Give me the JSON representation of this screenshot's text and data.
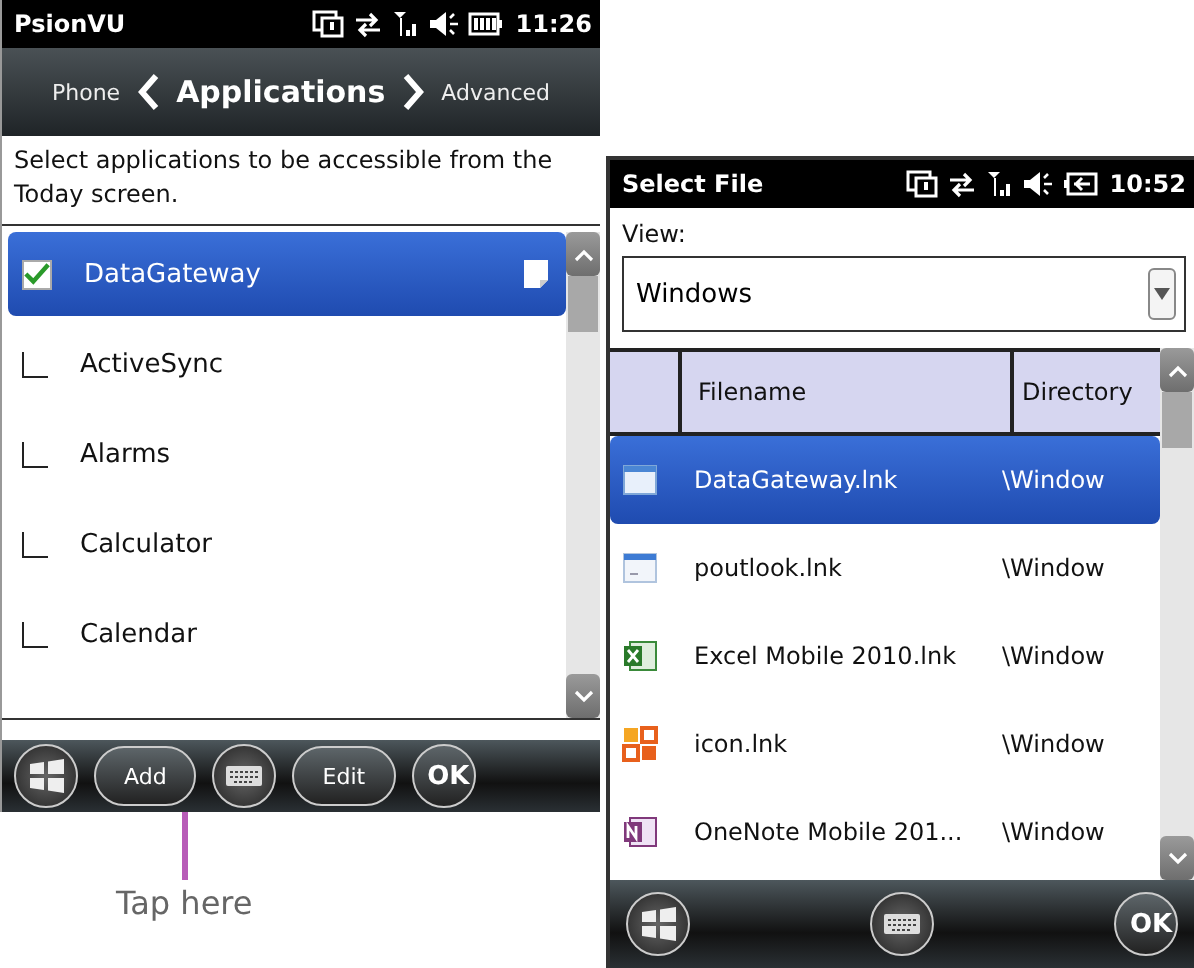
{
  "left_screen": {
    "status_bar": {
      "title": "PsionVU",
      "time": "11:26"
    },
    "nav_bar": {
      "previous": "Phone",
      "title": "Applications",
      "next": "Advanced"
    },
    "prompt": "Select applications to be accessible from the Today screen.",
    "apps": [
      {
        "name": "DataGateway",
        "checked": true,
        "selected": true
      },
      {
        "name": "ActiveSync",
        "checked": false,
        "selected": false
      },
      {
        "name": "Alarms",
        "checked": false,
        "selected": false
      },
      {
        "name": "Calculator",
        "checked": false,
        "selected": false
      },
      {
        "name": "Calendar",
        "checked": false,
        "selected": false
      }
    ],
    "softkeys": [
      {
        "kind": "start"
      },
      {
        "kind": "text",
        "label": "Add"
      },
      {
        "kind": "keyboard"
      },
      {
        "kind": "text",
        "label": "Edit"
      },
      {
        "kind": "text",
        "label": "OK"
      }
    ]
  },
  "callout": {
    "text": "Tap here"
  },
  "right_screen": {
    "status_bar": {
      "title": "Select File",
      "time": "10:52"
    },
    "view_label": "View:",
    "view_dropdown": {
      "value": "Windows"
    },
    "columns": [
      "Filename",
      "Directory"
    ],
    "files": [
      {
        "name": "DataGateway.lnk",
        "directory": "\\Window",
        "kind": "window",
        "selected": true
      },
      {
        "name": "poutlook.lnk",
        "directory": "\\Window",
        "kind": "outlook",
        "selected": false
      },
      {
        "name": "Excel Mobile 2010.lnk",
        "directory": "\\Window",
        "kind": "excel",
        "selected": false
      },
      {
        "name": "icon.lnk",
        "directory": "\\Window",
        "kind": "office",
        "selected": false
      },
      {
        "name": "OneNote Mobile 201...",
        "directory": "\\Window",
        "kind": "onenote",
        "selected": false
      }
    ],
    "softkeys": [
      {
        "kind": "start"
      },
      {
        "kind": "keyboard"
      },
      {
        "kind": "text",
        "label": "OK"
      }
    ]
  }
}
